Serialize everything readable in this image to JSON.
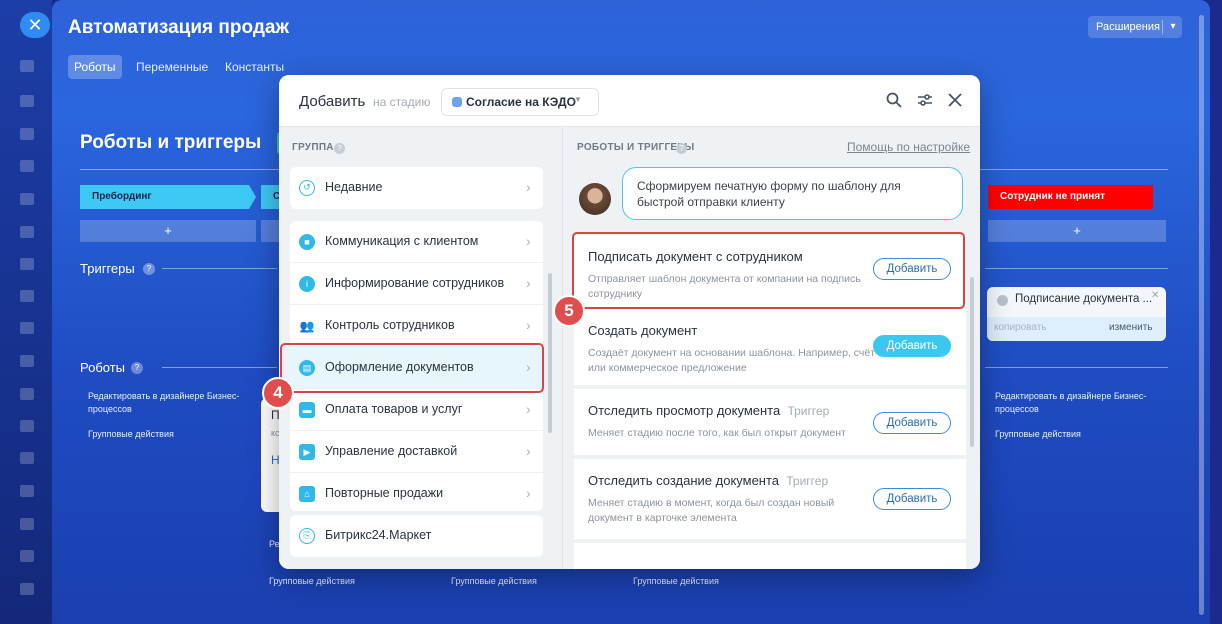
{
  "window": {
    "title": "Автоматизация продаж",
    "tabs": [
      "Роботы",
      "Переменные",
      "Константы"
    ],
    "extensions_label": "Расширения"
  },
  "background": {
    "heading": "Роботы и триггеры",
    "stages": [
      "Пребординг",
      "С",
      "Сотрудник не принят"
    ],
    "stage_colors": [
      "#3ec8f4",
      "#3ec8f4",
      "#ff0000"
    ],
    "add_symbol": "+",
    "triggers_label": "Триггеры",
    "robots_label": "Роботы",
    "edit_in_designer": "Редактировать в дизайнере Бизнес-процессов",
    "edit_short": "Редакт",
    "group_actions": "Групповые действия",
    "notification": {
      "text": "Подписание документа ...",
      "copy": "копировать",
      "edit": "изменить"
    },
    "partial_card": {
      "line1": "П",
      "line2": "кс",
      "line3": "Н"
    }
  },
  "dialog": {
    "title": "Добавить",
    "stage_label": "на стадию",
    "stage_value": "Согласие на КЭДО",
    "left": {
      "title": "ГРУППА",
      "items": [
        {
          "label": "Недавние",
          "icon": "clock-icon"
        },
        {
          "label": "Коммуникация с клиентом",
          "icon": "chat-icon"
        },
        {
          "label": "Информирование сотрудников",
          "icon": "info-icon"
        },
        {
          "label": "Контроль сотрудников",
          "icon": "people-icon"
        },
        {
          "label": "Оформление документов",
          "icon": "document-icon"
        },
        {
          "label": "Оплата товаров и услуг",
          "icon": "wallet-icon"
        },
        {
          "label": "Управление доставкой",
          "icon": "truck-icon"
        },
        {
          "label": "Повторные продажи",
          "icon": "shop-icon"
        },
        {
          "label": "Битрикс24.Маркет",
          "icon": "market-icon"
        }
      ]
    },
    "right": {
      "title": "РОБОТЫ И ТРИГГЕРЫ",
      "help_link": "Помощь по настройке",
      "bubble": "Сформируем печатную форму по шаблону для быстрой отправки клиенту",
      "cards": [
        {
          "title": "Подписать документ с сотрудником",
          "tag": "",
          "desc": "Отправляет шаблон документа от компании на подпись сотруднику",
          "button": "Добавить"
        },
        {
          "title": "Создать документ",
          "tag": "",
          "desc": "Создаёт документ на основании шаблона. Например, счёт или коммерческое предложение",
          "button": "Добавить"
        },
        {
          "title": "Отследить просмотр документа",
          "tag": "Триггер",
          "desc": "Меняет стадию после того, как был открыт документ",
          "button": "Добавить"
        },
        {
          "title": "Отследить создание документа",
          "tag": "Триггер",
          "desc": "Меняет стадию в момент, когда был создан новый документ в карточке элемента",
          "button": "Добавить"
        }
      ]
    }
  },
  "badges": {
    "step4": "4",
    "step5": "5"
  },
  "accents": {
    "highlight": "#d94545",
    "primary": "#3bc8f0"
  }
}
